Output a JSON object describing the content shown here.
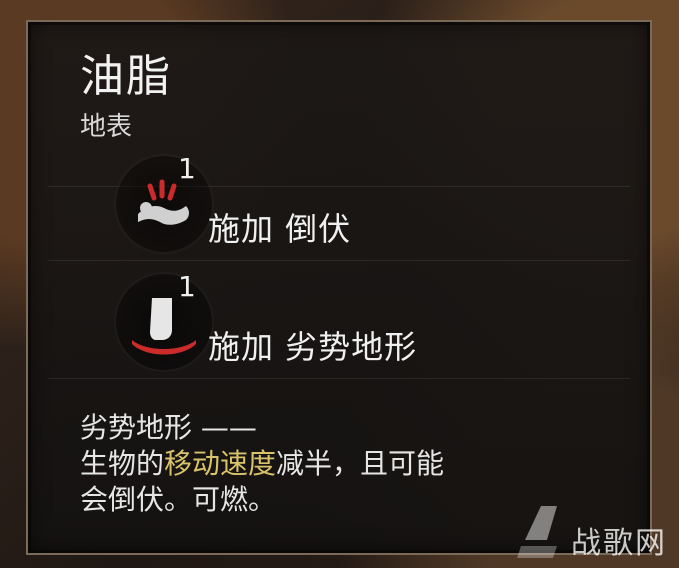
{
  "item": {
    "title": "油脂",
    "subtitle": "地表"
  },
  "effects": [
    {
      "count": "1",
      "label": "施加 倒伏"
    },
    {
      "count": "1",
      "label": "施加 劣势地形"
    }
  ],
  "description": {
    "line1": "劣势地形 ——",
    "line2_prefix": "生物的",
    "line2_highlight": "移动速度",
    "line2_suffix": "减半，且可能",
    "line3": "会倒伏。可燃。"
  },
  "watermark": "战歌网"
}
